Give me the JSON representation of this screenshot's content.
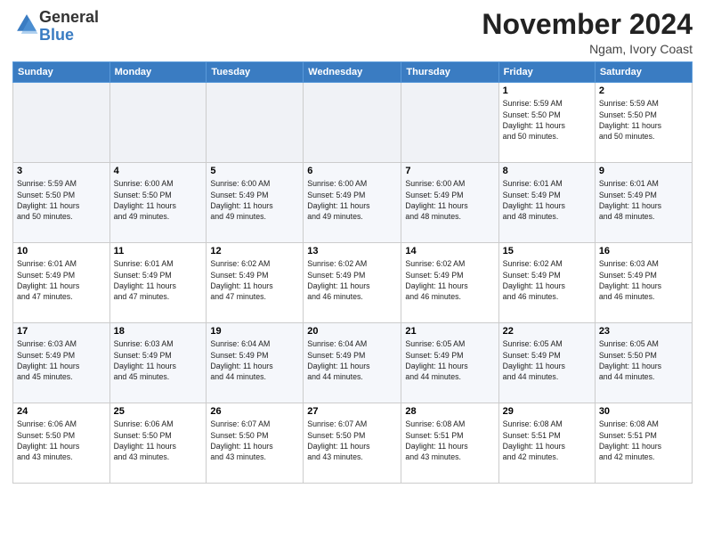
{
  "logo": {
    "general": "General",
    "blue": "Blue"
  },
  "header": {
    "month": "November 2024",
    "location": "Ngam, Ivory Coast"
  },
  "weekdays": [
    "Sunday",
    "Monday",
    "Tuesday",
    "Wednesday",
    "Thursday",
    "Friday",
    "Saturday"
  ],
  "weeks": [
    [
      {
        "day": "",
        "info": ""
      },
      {
        "day": "",
        "info": ""
      },
      {
        "day": "",
        "info": ""
      },
      {
        "day": "",
        "info": ""
      },
      {
        "day": "",
        "info": ""
      },
      {
        "day": "1",
        "info": "Sunrise: 5:59 AM\nSunset: 5:50 PM\nDaylight: 11 hours\nand 50 minutes."
      },
      {
        "day": "2",
        "info": "Sunrise: 5:59 AM\nSunset: 5:50 PM\nDaylight: 11 hours\nand 50 minutes."
      }
    ],
    [
      {
        "day": "3",
        "info": "Sunrise: 5:59 AM\nSunset: 5:50 PM\nDaylight: 11 hours\nand 50 minutes."
      },
      {
        "day": "4",
        "info": "Sunrise: 6:00 AM\nSunset: 5:50 PM\nDaylight: 11 hours\nand 49 minutes."
      },
      {
        "day": "5",
        "info": "Sunrise: 6:00 AM\nSunset: 5:49 PM\nDaylight: 11 hours\nand 49 minutes."
      },
      {
        "day": "6",
        "info": "Sunrise: 6:00 AM\nSunset: 5:49 PM\nDaylight: 11 hours\nand 49 minutes."
      },
      {
        "day": "7",
        "info": "Sunrise: 6:00 AM\nSunset: 5:49 PM\nDaylight: 11 hours\nand 48 minutes."
      },
      {
        "day": "8",
        "info": "Sunrise: 6:01 AM\nSunset: 5:49 PM\nDaylight: 11 hours\nand 48 minutes."
      },
      {
        "day": "9",
        "info": "Sunrise: 6:01 AM\nSunset: 5:49 PM\nDaylight: 11 hours\nand 48 minutes."
      }
    ],
    [
      {
        "day": "10",
        "info": "Sunrise: 6:01 AM\nSunset: 5:49 PM\nDaylight: 11 hours\nand 47 minutes."
      },
      {
        "day": "11",
        "info": "Sunrise: 6:01 AM\nSunset: 5:49 PM\nDaylight: 11 hours\nand 47 minutes."
      },
      {
        "day": "12",
        "info": "Sunrise: 6:02 AM\nSunset: 5:49 PM\nDaylight: 11 hours\nand 47 minutes."
      },
      {
        "day": "13",
        "info": "Sunrise: 6:02 AM\nSunset: 5:49 PM\nDaylight: 11 hours\nand 46 minutes."
      },
      {
        "day": "14",
        "info": "Sunrise: 6:02 AM\nSunset: 5:49 PM\nDaylight: 11 hours\nand 46 minutes."
      },
      {
        "day": "15",
        "info": "Sunrise: 6:02 AM\nSunset: 5:49 PM\nDaylight: 11 hours\nand 46 minutes."
      },
      {
        "day": "16",
        "info": "Sunrise: 6:03 AM\nSunset: 5:49 PM\nDaylight: 11 hours\nand 46 minutes."
      }
    ],
    [
      {
        "day": "17",
        "info": "Sunrise: 6:03 AM\nSunset: 5:49 PM\nDaylight: 11 hours\nand 45 minutes."
      },
      {
        "day": "18",
        "info": "Sunrise: 6:03 AM\nSunset: 5:49 PM\nDaylight: 11 hours\nand 45 minutes."
      },
      {
        "day": "19",
        "info": "Sunrise: 6:04 AM\nSunset: 5:49 PM\nDaylight: 11 hours\nand 44 minutes."
      },
      {
        "day": "20",
        "info": "Sunrise: 6:04 AM\nSunset: 5:49 PM\nDaylight: 11 hours\nand 44 minutes."
      },
      {
        "day": "21",
        "info": "Sunrise: 6:05 AM\nSunset: 5:49 PM\nDaylight: 11 hours\nand 44 minutes."
      },
      {
        "day": "22",
        "info": "Sunrise: 6:05 AM\nSunset: 5:49 PM\nDaylight: 11 hours\nand 44 minutes."
      },
      {
        "day": "23",
        "info": "Sunrise: 6:05 AM\nSunset: 5:50 PM\nDaylight: 11 hours\nand 44 minutes."
      }
    ],
    [
      {
        "day": "24",
        "info": "Sunrise: 6:06 AM\nSunset: 5:50 PM\nDaylight: 11 hours\nand 43 minutes."
      },
      {
        "day": "25",
        "info": "Sunrise: 6:06 AM\nSunset: 5:50 PM\nDaylight: 11 hours\nand 43 minutes."
      },
      {
        "day": "26",
        "info": "Sunrise: 6:07 AM\nSunset: 5:50 PM\nDaylight: 11 hours\nand 43 minutes."
      },
      {
        "day": "27",
        "info": "Sunrise: 6:07 AM\nSunset: 5:50 PM\nDaylight: 11 hours\nand 43 minutes."
      },
      {
        "day": "28",
        "info": "Sunrise: 6:08 AM\nSunset: 5:51 PM\nDaylight: 11 hours\nand 43 minutes."
      },
      {
        "day": "29",
        "info": "Sunrise: 6:08 AM\nSunset: 5:51 PM\nDaylight: 11 hours\nand 42 minutes."
      },
      {
        "day": "30",
        "info": "Sunrise: 6:08 AM\nSunset: 5:51 PM\nDaylight: 11 hours\nand 42 minutes."
      }
    ]
  ]
}
